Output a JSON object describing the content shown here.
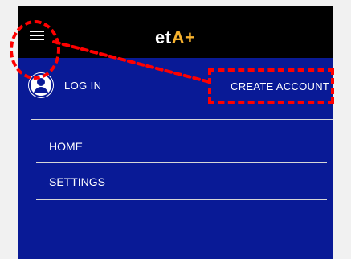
{
  "header": {
    "logo_prefix": "et",
    "logo_accent": "A+",
    "menu_icon": "hamburger-menu-icon"
  },
  "account": {
    "login_label": "LOG IN",
    "create_account_label": "CREATE ACCOUNT",
    "avatar_icon": "user-circle-icon"
  },
  "menu": {
    "items": [
      {
        "label": "HOME"
      },
      {
        "label": "SETTINGS"
      }
    ]
  },
  "colors": {
    "header_bg": "#000000",
    "panel_bg": "#091a96",
    "logo_accent": "#f7b22e",
    "highlight": "#ff0000",
    "divider": "#d6d6d6"
  }
}
